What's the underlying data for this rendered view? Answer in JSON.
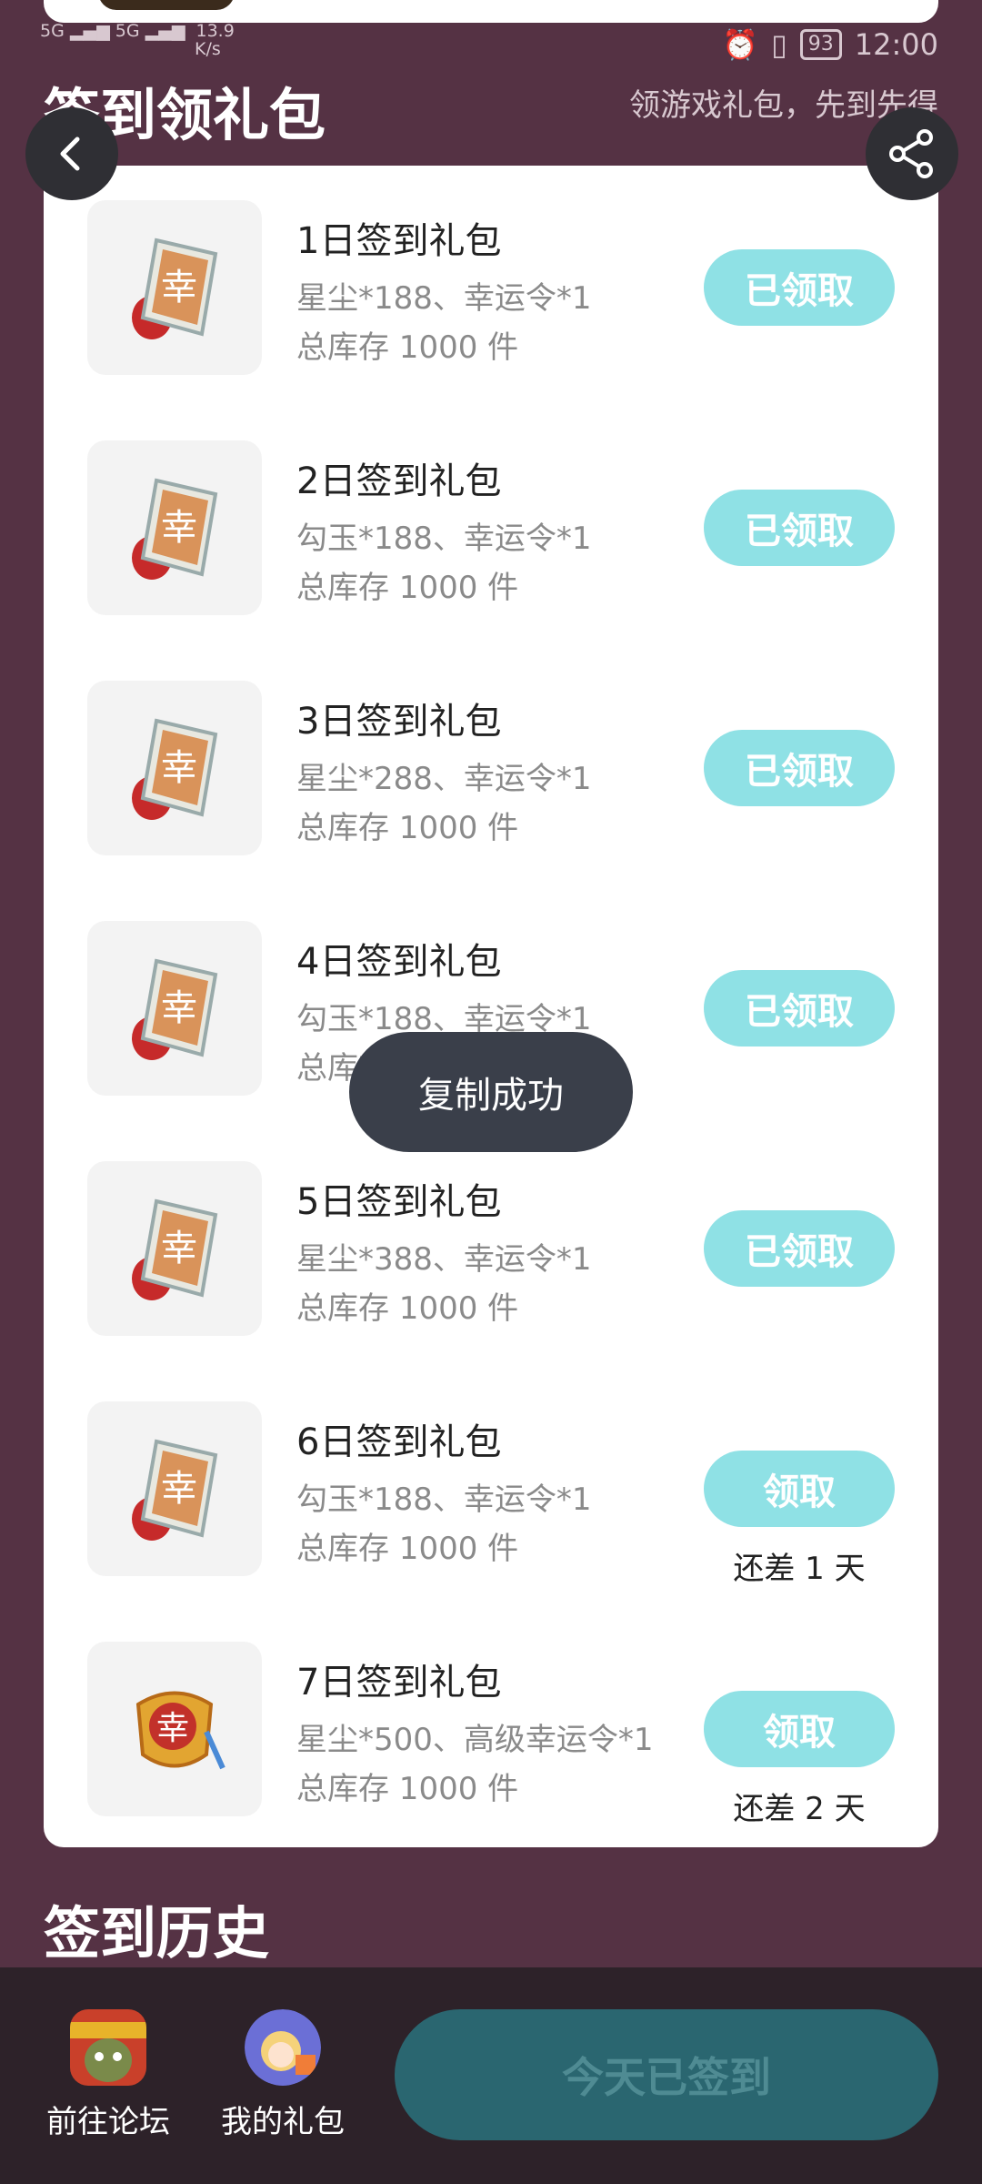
{
  "status_bar": {
    "signal_left": "5G",
    "signal_right": "5G",
    "net_speed": "13.9",
    "net_unit": "K/s",
    "battery": "93",
    "time": "12:00"
  },
  "header": {
    "title": "签到领礼包",
    "subtitle": "领游戏礼包，先到先得"
  },
  "gifts": [
    {
      "title": "1日签到礼包",
      "desc": "星尘*188、幸运令*1",
      "stock": "总库存 1000 件",
      "button": "已领取",
      "remain": ""
    },
    {
      "title": "2日签到礼包",
      "desc": "勾玉*188、幸运令*1",
      "stock": "总库存 1000 件",
      "button": "已领取",
      "remain": ""
    },
    {
      "title": "3日签到礼包",
      "desc": "星尘*288、幸运令*1",
      "stock": "总库存 1000 件",
      "button": "已领取",
      "remain": ""
    },
    {
      "title": "4日签到礼包",
      "desc": "勾玉*188、幸运令*1",
      "stock": "总库存 1000 件",
      "button": "已领取",
      "remain": ""
    },
    {
      "title": "5日签到礼包",
      "desc": "星尘*388、幸运令*1",
      "stock": "总库存 1000 件",
      "button": "已领取",
      "remain": ""
    },
    {
      "title": "6日签到礼包",
      "desc": "勾玉*188、幸运令*1",
      "stock": "总库存 1000 件",
      "button": "领取",
      "remain": "还差 1 天"
    },
    {
      "title": "7日签到礼包",
      "desc": "星尘*500、高级幸运令*1",
      "stock": "总库存 1000 件",
      "button": "领取",
      "remain": "还差 2 天"
    }
  ],
  "toast": "复制成功",
  "history_title": "签到历史",
  "bottom": {
    "forum_label": "前往论坛",
    "gifts_label": "我的礼包",
    "signed_label": "今天已签到"
  },
  "colors": {
    "background": "#553244",
    "claim_button": "#8fe1e5",
    "signed_button": "#2a6670"
  }
}
